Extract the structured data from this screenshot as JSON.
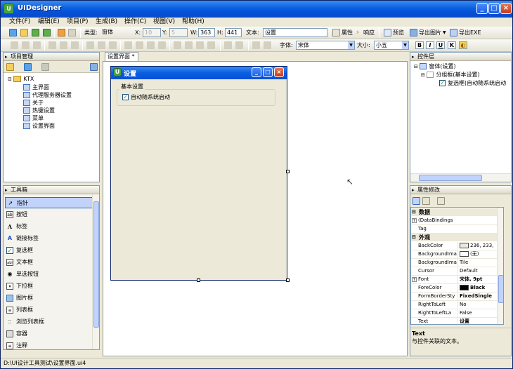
{
  "app": {
    "title": "UIDesigner"
  },
  "menu": [
    "文件(F)",
    "编辑(E)",
    "项目(P)",
    "生成(B)",
    "操作(C)",
    "视图(V)",
    "帮助(H)"
  ],
  "toolbar": {
    "type_label": "类型:",
    "type_value": "窗体",
    "x_label": "X:",
    "x_value": "10",
    "y_label": "Y:",
    "y_value": "5",
    "w_label": "W:",
    "w_value": "363",
    "h_label": "H:",
    "h_value": "441",
    "text_label": "文本:",
    "text_value": "设置",
    "props_label": "属性",
    "respond_label": "响应",
    "preview_label": "预览",
    "export_image_label": "导出图片",
    "export_exe_label": "导出EXE",
    "font_label": "字体:",
    "font_value": "宋体",
    "size_label": "大小:",
    "size_value": "小五",
    "bold": "B",
    "italic": "I",
    "underline": "U",
    "k_label": "K"
  },
  "project_panel": {
    "title": "项目管理",
    "root": "KTX",
    "items": [
      "主界面",
      "代理服务器设置",
      "关于",
      "热键设置",
      "菜单",
      "设置界面"
    ]
  },
  "toolbox": {
    "title": "工具箱",
    "items": [
      {
        "label": "指针",
        "icon": "pointer-icon"
      },
      {
        "label": "按钮",
        "icon": "button-icon"
      },
      {
        "label": "标签",
        "icon": "label-icon"
      },
      {
        "label": "链接标签",
        "icon": "link-label-icon"
      },
      {
        "label": "复选框",
        "icon": "checkbox-icon"
      },
      {
        "label": "文本框",
        "icon": "textbox-icon"
      },
      {
        "label": "单选按钮",
        "icon": "radio-icon"
      },
      {
        "label": "下拉框",
        "icon": "combobox-icon"
      },
      {
        "label": "图片框",
        "icon": "picturebox-icon"
      },
      {
        "label": "列表框",
        "icon": "listbox-icon"
      },
      {
        "label": "浏览列表框",
        "icon": "listview-icon"
      },
      {
        "label": "容器",
        "icon": "container-icon"
      },
      {
        "label": "注释",
        "icon": "comment-icon"
      }
    ]
  },
  "designer": {
    "tab": "设置界面 *",
    "form_title": "设置",
    "group_title": "基本设置",
    "checkbox_label": "自动随系统启动"
  },
  "controls_panel": {
    "title": "控件层",
    "items": [
      "窗体(设置)",
      "分组框(基本设置)",
      "复选框(自动随系统启动"
    ]
  },
  "properties_panel": {
    "title": "属性修改",
    "categories": [
      "数据",
      "外观"
    ],
    "rows": [
      {
        "name": "(DataBindings",
        "value": ""
      },
      {
        "name": "Tag",
        "value": ""
      },
      {
        "name": "BackColor",
        "value": "236, 233,"
      },
      {
        "name": "BackgroundIma",
        "value": "(无)"
      },
      {
        "name": "BackgroundIma",
        "value": "Tile"
      },
      {
        "name": "Cursor",
        "value": "Default"
      },
      {
        "name": "Font",
        "value": "宋体, 9pt"
      },
      {
        "name": "ForeColor",
        "value": "Black"
      },
      {
        "name": "FormBorderSty",
        "value": "FixedSingle"
      },
      {
        "name": "RightToLeft",
        "value": "No"
      },
      {
        "name": "RightToLeftLa",
        "value": "False"
      },
      {
        "name": "Text",
        "value": "设置"
      }
    ],
    "desc_title": "Text",
    "desc_text": "与控件关联的文本。"
  },
  "status": {
    "path": "D:\\UI设计工具测试\\设置界面.ui4"
  },
  "colors": {
    "titlebar": "#0a5ee0",
    "panel_bg": "#ece9d8",
    "backcolor_swatch": "#ece9d8",
    "forecolor_swatch": "#000000"
  }
}
